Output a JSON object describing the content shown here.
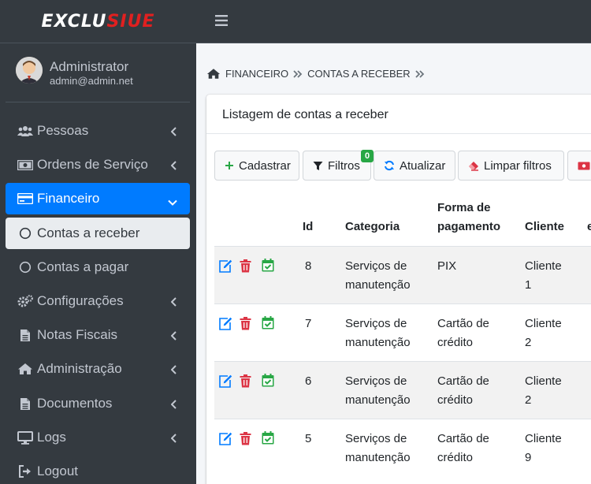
{
  "brand": {
    "part1": "EXCLU",
    "part2": "SIUE"
  },
  "user": {
    "name": "Administrator",
    "email": "admin@admin.net"
  },
  "sidebar": {
    "items": [
      {
        "label": "Pessoas"
      },
      {
        "label": "Ordens de Serviço"
      },
      {
        "label": "Financeiro"
      },
      {
        "label": "Contas a receber"
      },
      {
        "label": "Contas a pagar"
      },
      {
        "label": "Configurações"
      },
      {
        "label": "Notas Fiscais"
      },
      {
        "label": "Administração"
      },
      {
        "label": "Documentos"
      },
      {
        "label": "Logs"
      },
      {
        "label": "Logout"
      }
    ]
  },
  "breadcrumb": {
    "item1": "FINANCEIRO",
    "item2": "CONTAS A RECEBER"
  },
  "card": {
    "title": "Listagem de contas a receber"
  },
  "toolbar": {
    "cadastrar": "Cadastrar",
    "filtros": "Filtros",
    "filtros_badge": "0",
    "atualizar": "Atualizar",
    "limpar": "Limpar filtros"
  },
  "table": {
    "headers": {
      "id": "Id",
      "categoria": "Categoria",
      "forma_1": "Forma de",
      "forma_2": "pagamento",
      "cliente": "Cliente",
      "extra": "e"
    },
    "rows": [
      {
        "id": "8",
        "cat1": "Serviços de",
        "cat2": "manutenção",
        "forma1": "PIX",
        "forma2": "",
        "cli1": "Cliente",
        "cli2": "1"
      },
      {
        "id": "7",
        "cat1": "Serviços de",
        "cat2": "manutenção",
        "forma1": "Cartão de",
        "forma2": "crédito",
        "cli1": "Cliente",
        "cli2": "2"
      },
      {
        "id": "6",
        "cat1": "Serviços de",
        "cat2": "manutenção",
        "forma1": "Cartão de",
        "forma2": "crédito",
        "cli1": "Cliente",
        "cli2": "2"
      },
      {
        "id": "5",
        "cat1": "Serviços de",
        "cat2": "manutenção",
        "forma1": "Cartão de",
        "forma2": "crédito",
        "cli1": "Cliente",
        "cli2": "9"
      }
    ]
  },
  "colors": {
    "sidebar": "#343a40",
    "accent": "#007bff",
    "success": "#28a745",
    "danger": "#dc3545",
    "edit": "#007bff"
  }
}
